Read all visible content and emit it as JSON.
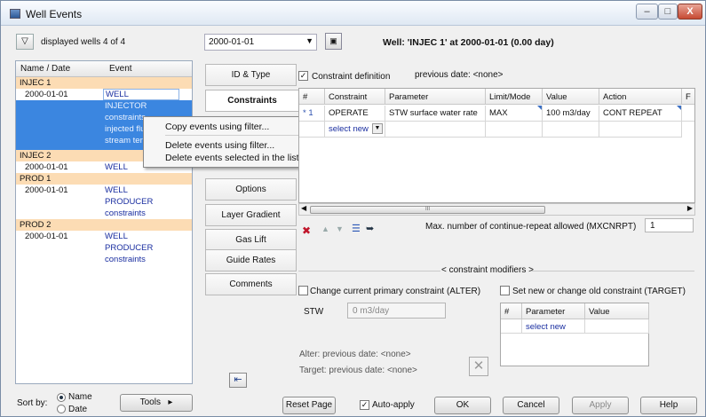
{
  "window": {
    "title": "Well Events",
    "minimize": "–",
    "maximize": "□",
    "close": "X"
  },
  "toolbar": {
    "filter_icon": "filter-icon",
    "displayed": "displayed wells 4 of 4",
    "date": "2000-01-01",
    "well_title": "Well: 'INJEC 1'  at  2000-01-01 (0.00 day)"
  },
  "list": {
    "headers": {
      "name": "Name / Date",
      "event": "Event"
    },
    "rows": [
      {
        "c1": "INJEC 1",
        "c2": ""
      },
      {
        "c1": "2000-01-01",
        "c2": "WELL"
      },
      {
        "c1": "",
        "c2": "INJECTOR"
      },
      {
        "c1": "",
        "c2": "constraints"
      },
      {
        "c1": "",
        "c2": "injected flu"
      },
      {
        "c1": "",
        "c2": "stream ter"
      },
      {
        "c1": "INJEC 2",
        "c2": ""
      },
      {
        "c1": "2000-01-01",
        "c2": "WELL"
      },
      {
        "c1": "PROD 1",
        "c2": ""
      },
      {
        "c1": "2000-01-01",
        "c2": "WELL"
      },
      {
        "c1": "",
        "c2": "PRODUCER"
      },
      {
        "c1": "",
        "c2": "constraints"
      },
      {
        "c1": "PROD 2",
        "c2": ""
      },
      {
        "c1": "2000-01-01",
        "c2": "WELL"
      },
      {
        "c1": "",
        "c2": "PRODUCER"
      },
      {
        "c1": "",
        "c2": "constraints"
      }
    ]
  },
  "context_menu": [
    "Copy events using filter...",
    "Delete events using filter...",
    "Delete events selected in the list"
  ],
  "sort": {
    "label": "Sort by:",
    "name": "Name",
    "date": "Date",
    "tools": "Tools",
    "tools_arrow": "▸"
  },
  "tabs": [
    "ID & Type",
    "Constraints",
    "",
    "Options",
    "Layer Gradient",
    "Gas Lift",
    "Guide Rates",
    "Comments"
  ],
  "constraints": {
    "definition_label": "Constraint definition",
    "previous_date": "previous date: <none>",
    "grid_headers": [
      "#",
      "Constraint",
      "Parameter",
      "Limit/Mode",
      "Value",
      "Action",
      "F"
    ],
    "row1": [
      "* 1",
      "OPERATE",
      "STW surface water rate",
      "MAX",
      "100 m3/day",
      "CONT REPEAT",
      ""
    ],
    "select_new": "select new",
    "scroll_marker": "III",
    "mxcnrpt_label": "Max. number of continue-repeat allowed (MXCNRPT)",
    "mxcnrpt_value": "1"
  },
  "modifiers": {
    "title": "< constraint modifiers >",
    "alter_label": "Change current primary constraint (ALTER)",
    "target_label": "Set new or change old constraint (TARGET)",
    "stw": "STW",
    "stw_value": "0 m3/day",
    "table_headers": [
      "#",
      "Parameter",
      "Value"
    ],
    "select_new": "select new",
    "alter_prev": "Alter:    previous date: <none>",
    "target_prev": "Target: previous date: <none>"
  },
  "footer": {
    "reset": "Reset Page",
    "auto_apply": "Auto-apply",
    "ok": "OK",
    "cancel": "Cancel",
    "apply": "Apply",
    "help": "Help"
  }
}
